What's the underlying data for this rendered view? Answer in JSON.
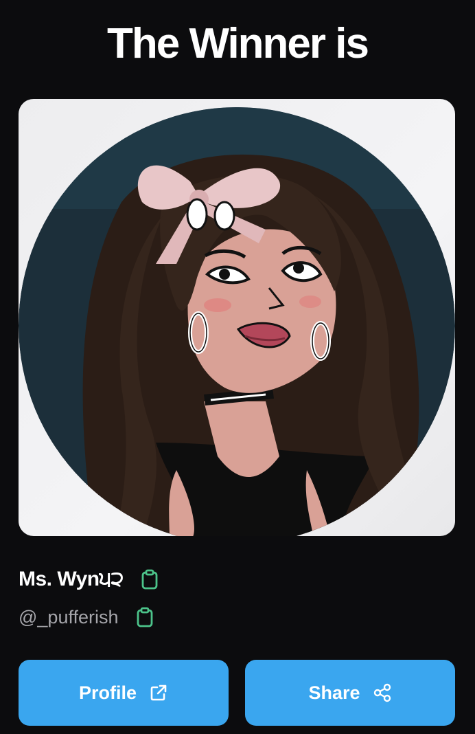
{
  "header": {
    "title": "The Winner is"
  },
  "winner": {
    "display_name": "Ms. Wyn੫੨",
    "handle": "@_pufferish",
    "avatar_icon": "cartoon-girl-avatar"
  },
  "actions": {
    "profile_label": "Profile",
    "share_label": "Share"
  },
  "colors": {
    "background": "#0c0c0e",
    "button": "#3aa6ef",
    "copy_icon": "#4cc38a",
    "handle_text": "#a6a6ab"
  },
  "icons": {
    "copy": "clipboard-icon",
    "profile": "external-link-icon",
    "share": "share-icon"
  }
}
